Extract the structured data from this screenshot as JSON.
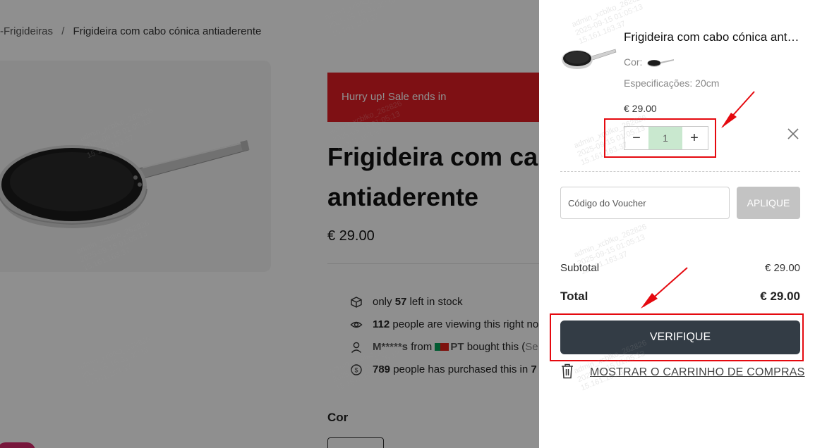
{
  "breadcrumb": {
    "parent": "-Frigideiras",
    "separator": "/",
    "current": "Frigideira com cabo cónica antiaderente"
  },
  "product": {
    "sale_banner": "Hurry up!  Sale ends in",
    "title_line1": "Frigideira com ca",
    "title_line2": "antiaderente",
    "price": "€ 29.00",
    "info": {
      "stock_pre": "only ",
      "stock_count": "57",
      "stock_post": " left in stock",
      "viewing_count": "112",
      "viewing_text": " people are viewing this right no",
      "buyer_name": "M*****s",
      "buyer_from": " from ",
      "buyer_country": "PT",
      "buyer_action": " bought this (",
      "buyer_trail": "Se",
      "purchased_count": "789",
      "purchased_text": " people has purchased this in ",
      "purchased_trail": "7"
    },
    "color_label": "Cor"
  },
  "cart": {
    "item": {
      "name": "Frigideira com cabo cónica antiaderente",
      "color_label": "Cor:",
      "spec": "Especificações: 20cm",
      "price": "€ 29.00",
      "quantity": "1",
      "minus": "−",
      "plus": "+"
    },
    "voucher_placeholder": "Código do Voucher",
    "apply_label": "APLIQUE",
    "subtotal_label": "Subtotal",
    "subtotal_value": "€ 29.00",
    "total_label": "Total",
    "total_value": "€ 29.00",
    "checkout_label": "VERIFIQUE",
    "view_cart_label": "MOSTRAR O CARRINHO DE COMPRAS"
  },
  "watermark": "admin_xcblko_262826\n2025-09-15 01:05:13\n15.161.163.37",
  "colors": {
    "sale_red": "#e01e25",
    "checkout_dark": "#333c45",
    "quantity_bg": "#c9e8cf",
    "annotation_red": "#e5090f"
  }
}
